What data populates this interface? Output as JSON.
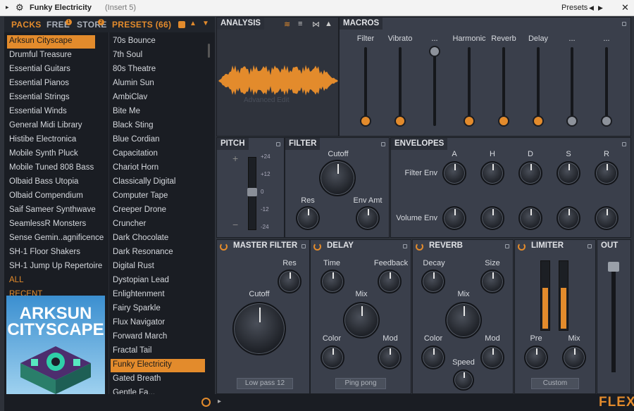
{
  "titlebar": {
    "title": "Funky Electricity",
    "subtitle": "(Insert 5)",
    "presets_label": "Presets"
  },
  "tabs": {
    "packs": "PACKS",
    "free": "FREE",
    "free_badge": "1",
    "store": "STORE",
    "store_badge": "2",
    "presets": "PRESETS (66)"
  },
  "packs": [
    "Arksun Cityscape",
    "Drumful Treasure",
    "Essential Guitars",
    "Essential Pianos",
    "Essential Strings",
    "Essential Winds",
    "General Midi Library",
    "Histibe Electronica",
    "Mobile Synth Pluck",
    "Mobile Tuned 808 Bass",
    "Olbaid Bass Utopia",
    "Olbaid Compendium",
    "Saif Sameer Synthwave",
    "SeamlessR Monsters",
    "Sense Gemin..agnificence",
    "SH-1 Floor Shakers",
    "SH-1 Jump Up Repertoire",
    "ALL",
    "RECENT"
  ],
  "pack_art": {
    "line1": "ARKSUN",
    "line2": "CITYSCAPE"
  },
  "presets": [
    "70s Bounce",
    "7th Soul",
    "80s Theatre",
    "Alumin Sun",
    "AmbiClav",
    "Bite Me",
    "Black Sting",
    "Blue Cordian",
    "Capacitation",
    "Chariot Horn",
    "Classically Digital",
    "Computer Tape",
    "Creeper Drone",
    "Cruncher",
    "Dark Chocolate",
    "Dark Resonance",
    "Digital Rust",
    "Dystopian Lead",
    "Enlightenment",
    "Fairy Sparkle",
    "Flux Navigator",
    "Forward March",
    "Fractal Tail",
    "Funky Electricity",
    "Gated Breath",
    "Gentle Fa..."
  ],
  "analysis": {
    "title": "ANALYSIS",
    "watermark": "Advanced Edit"
  },
  "macros": {
    "title": "MACROS",
    "labels": [
      "Filter",
      "Vibrato",
      "...",
      "Harmonic",
      "Reverb",
      "Delay",
      "...",
      "..."
    ],
    "values": [
      0.0,
      0.0,
      1.0,
      0.0,
      0.0,
      0.0,
      0.0,
      0.0
    ],
    "colors": [
      "orange",
      "orange",
      "gray",
      "orange",
      "orange",
      "orange",
      "gray",
      "gray"
    ]
  },
  "pitch": {
    "title": "PITCH",
    "ticks": [
      "+24",
      "+12",
      "0",
      "-12",
      "-24"
    ],
    "plus": "+",
    "minus": "−"
  },
  "filter": {
    "title": "FILTER",
    "cutoff": "Cutoff",
    "res": "Res",
    "env_amt": "Env Amt"
  },
  "envelopes": {
    "title": "ENVELOPES",
    "cols": [
      "A",
      "H",
      "D",
      "S",
      "R"
    ],
    "rows": [
      "Filter Env",
      "Volume Env"
    ]
  },
  "master_filter": {
    "title": "MASTER FILTER",
    "res": "Res",
    "cutoff": "Cutoff",
    "mode": "Low pass 12"
  },
  "delay": {
    "title": "DELAY",
    "time": "Time",
    "feedback": "Feedback",
    "mix": "Mix",
    "color": "Color",
    "mod": "Mod",
    "mode": "Ping pong"
  },
  "reverb": {
    "title": "REVERB",
    "decay": "Decay",
    "size": "Size",
    "mix": "Mix",
    "color": "Color",
    "mod": "Mod",
    "speed": "Speed"
  },
  "limiter": {
    "title": "LIMITER",
    "pre": "Pre",
    "mix": "Mix",
    "mode": "Custom"
  },
  "out": {
    "title": "OUT"
  },
  "brand": "FLEX",
  "colors": {
    "accent": "#e38b2c",
    "panel": "#3a3f4b",
    "dark": "#1a1d23"
  }
}
